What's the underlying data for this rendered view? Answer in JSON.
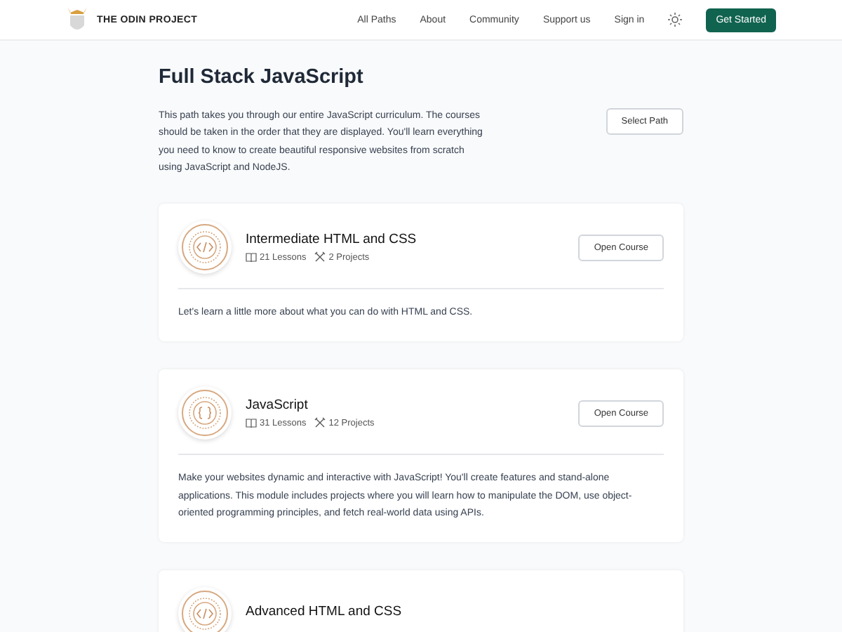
{
  "header": {
    "logo_text": "THE ODIN PROJECT",
    "nav": [
      {
        "label": "All Paths"
      },
      {
        "label": "About"
      },
      {
        "label": "Community"
      },
      {
        "label": "Support us"
      },
      {
        "label": "Sign in"
      }
    ],
    "cta": "Get Started"
  },
  "path": {
    "title": "Full Stack JavaScript",
    "description": "This path takes you through our entire JavaScript curriculum. The courses should be taken in the order that they are displayed. You'll learn everything you need to know to create beautiful responsive websites from scratch using JavaScript and NodeJS.",
    "button": "Select Path"
  },
  "courses": [
    {
      "kind": "code",
      "title": "Intermediate HTML and CSS",
      "lessons": "21 Lessons",
      "projects": "2 Projects",
      "button": "Open Course",
      "description": "Let's learn a little more about what you can do with HTML and CSS."
    },
    {
      "kind": "braces",
      "title": "JavaScript",
      "lessons": "31 Lessons",
      "projects": "12 Projects",
      "button": "Open Course",
      "description": "Make your websites dynamic and interactive with JavaScript! You'll create features and stand-alone applications. This module includes projects where you will learn how to manipulate the DOM, use object-oriented programming principles, and fetch real-world data using APIs."
    },
    {
      "kind": "code",
      "title": "Advanced HTML and CSS"
    }
  ]
}
